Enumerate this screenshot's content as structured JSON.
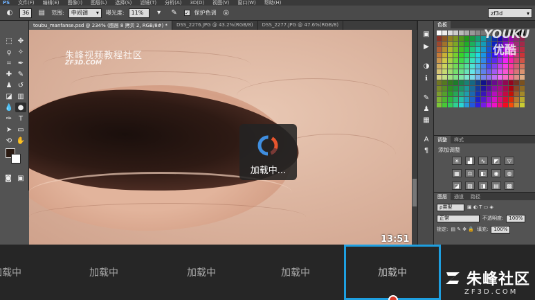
{
  "menubar": {
    "items": [
      "PS",
      "文件(F)",
      "编辑(E)",
      "图像(I)",
      "图层(L)",
      "选择(S)",
      "滤镜(T)",
      "分析(A)",
      "3D(D)",
      "视图(V)",
      "窗口(W)",
      "帮助(H)"
    ]
  },
  "options": {
    "brush_size": "36",
    "range_label": "范围:",
    "range_value": "中间调",
    "exposure_label": "曝光度:",
    "exposure_value": "11%",
    "protect_label": "保护色调",
    "protect_checked": "✓",
    "workspace": "zf3d"
  },
  "doc_tabs": [
    "toubu_manfanse.psd @ 234% (图层 8 拷贝 2, RGB/8#) *",
    "DSS_2276.JPG @ 43.2%(RGB/8)",
    "DSS_2277.JPG @ 47.6%(RGB/8)"
  ],
  "canvas": {
    "watermark_cn": "朱峰视频教程社区",
    "watermark_en": "ZF3D.COM"
  },
  "loader": {
    "text": "加载中..."
  },
  "panels": {
    "swatches_tab": "色板",
    "adjustments_tabs": [
      "调整",
      "样式"
    ],
    "adjustments_title": "添加调整",
    "layers_tabs": [
      "图层",
      "通道",
      "路径"
    ],
    "layer_kind": "ρ类型",
    "blend_mode": "正常",
    "opacity_label": "不透明度:",
    "opacity_value": "100%",
    "lock_label": "锁定:",
    "fill_label": "填充:",
    "fill_value": "100%"
  },
  "watermark": {
    "youku": "YOUKU",
    "youku_cn": "优酷"
  },
  "video_strip": {
    "items": [
      "加载中",
      "加载中",
      "加载中",
      "加载中",
      "加载中"
    ],
    "timestamp": "13:51",
    "brand": "朱峰社区",
    "brand_sub": "ZF3D.COM"
  }
}
